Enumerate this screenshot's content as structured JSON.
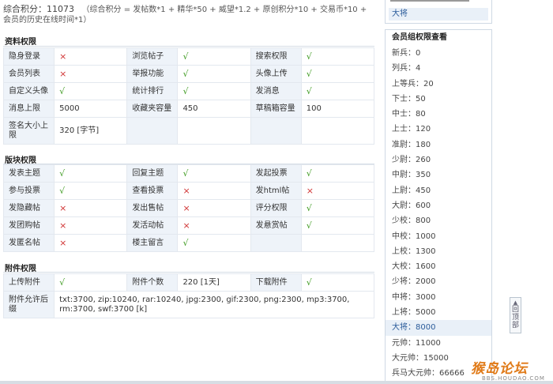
{
  "score": {
    "label": "综合积分：",
    "value": "11073",
    "formula": "（综合积分 = 发帖数*1 + 精华*50 + 威望*1.2 + 原创积分*10 + 交易币*10 + 会员的历史在线时间*1）"
  },
  "sections": {
    "profile": {
      "title": "资料权限",
      "rows": [
        [
          [
            "隐身登录",
            "×"
          ],
          [
            "浏览帖子",
            "√"
          ],
          [
            "搜索权限",
            "√"
          ]
        ],
        [
          [
            "会员列表",
            "×"
          ],
          [
            "举报功能",
            "√"
          ],
          [
            "头像上传",
            "√"
          ]
        ],
        [
          [
            "自定义头像",
            "√"
          ],
          [
            "统计排行",
            "√"
          ],
          [
            "发消息",
            "√"
          ]
        ],
        [
          [
            "消息上限",
            "5000"
          ],
          [
            "收藏夹容量",
            "450"
          ],
          [
            "草稿箱容量",
            "100"
          ]
        ],
        [
          [
            "签名大小上限",
            "320 [字节]"
          ],
          [
            "",
            ""
          ],
          [
            "",
            ""
          ]
        ]
      ]
    },
    "forum": {
      "title": "版块权限",
      "rows": [
        [
          [
            "发表主题",
            "√"
          ],
          [
            "回复主题",
            "√"
          ],
          [
            "发起投票",
            "√"
          ]
        ],
        [
          [
            "参与投票",
            "√"
          ],
          [
            "查看投票",
            "×"
          ],
          [
            "发html帖",
            "×"
          ]
        ],
        [
          [
            "发隐藏帖",
            "×"
          ],
          [
            "发出售帖",
            "×"
          ],
          [
            "评分权限",
            "√"
          ]
        ],
        [
          [
            "发团购帖",
            "×"
          ],
          [
            "发活动帖",
            "×"
          ],
          [
            "发悬赏帖",
            "√"
          ]
        ],
        [
          [
            "发匿名帖",
            "×"
          ],
          [
            "楼主留言",
            "√"
          ],
          [
            "",
            ""
          ]
        ]
      ]
    },
    "attachment": {
      "title": "附件权限",
      "row1": [
        [
          "上传附件",
          "√"
        ],
        [
          "附件个数",
          "220 [1天]"
        ],
        [
          "下载附件",
          "√"
        ]
      ],
      "types_label": "附件允许后缀",
      "types_value": "txt:3700, zip:10240, rar:10240, jpg:2300, gif:2300, png:2300, mp3:3700, rm:3700, swf:3700 [k]"
    }
  },
  "right_top": {
    "current": "大将"
  },
  "groups": {
    "title": "会员组权限查看",
    "active_index": 19,
    "items": [
      "新兵：0",
      "列兵：4",
      "上等兵：20",
      "下士：50",
      "中士：80",
      "上士：120",
      "准尉：180",
      "少尉：260",
      "中尉：350",
      "上尉：450",
      "大尉：600",
      "少校：800",
      "中校：1000",
      "上校：1300",
      "大校：1600",
      "少将：2000",
      "中将：3000",
      "上将：5000",
      "大将：8000",
      "元帅：11000",
      "大元帅：15000",
      "兵马大元帅：66666"
    ]
  },
  "back_top_label": "回顶部",
  "watermark": {
    "logo": "猴岛论坛",
    "domain": "BBS.HOUDAO.COM"
  },
  "colors": {
    "yes": "#3c9a1e",
    "no": "#d03232",
    "key_bg": "#eef3f9",
    "active_bg": "#e9f0f8"
  }
}
